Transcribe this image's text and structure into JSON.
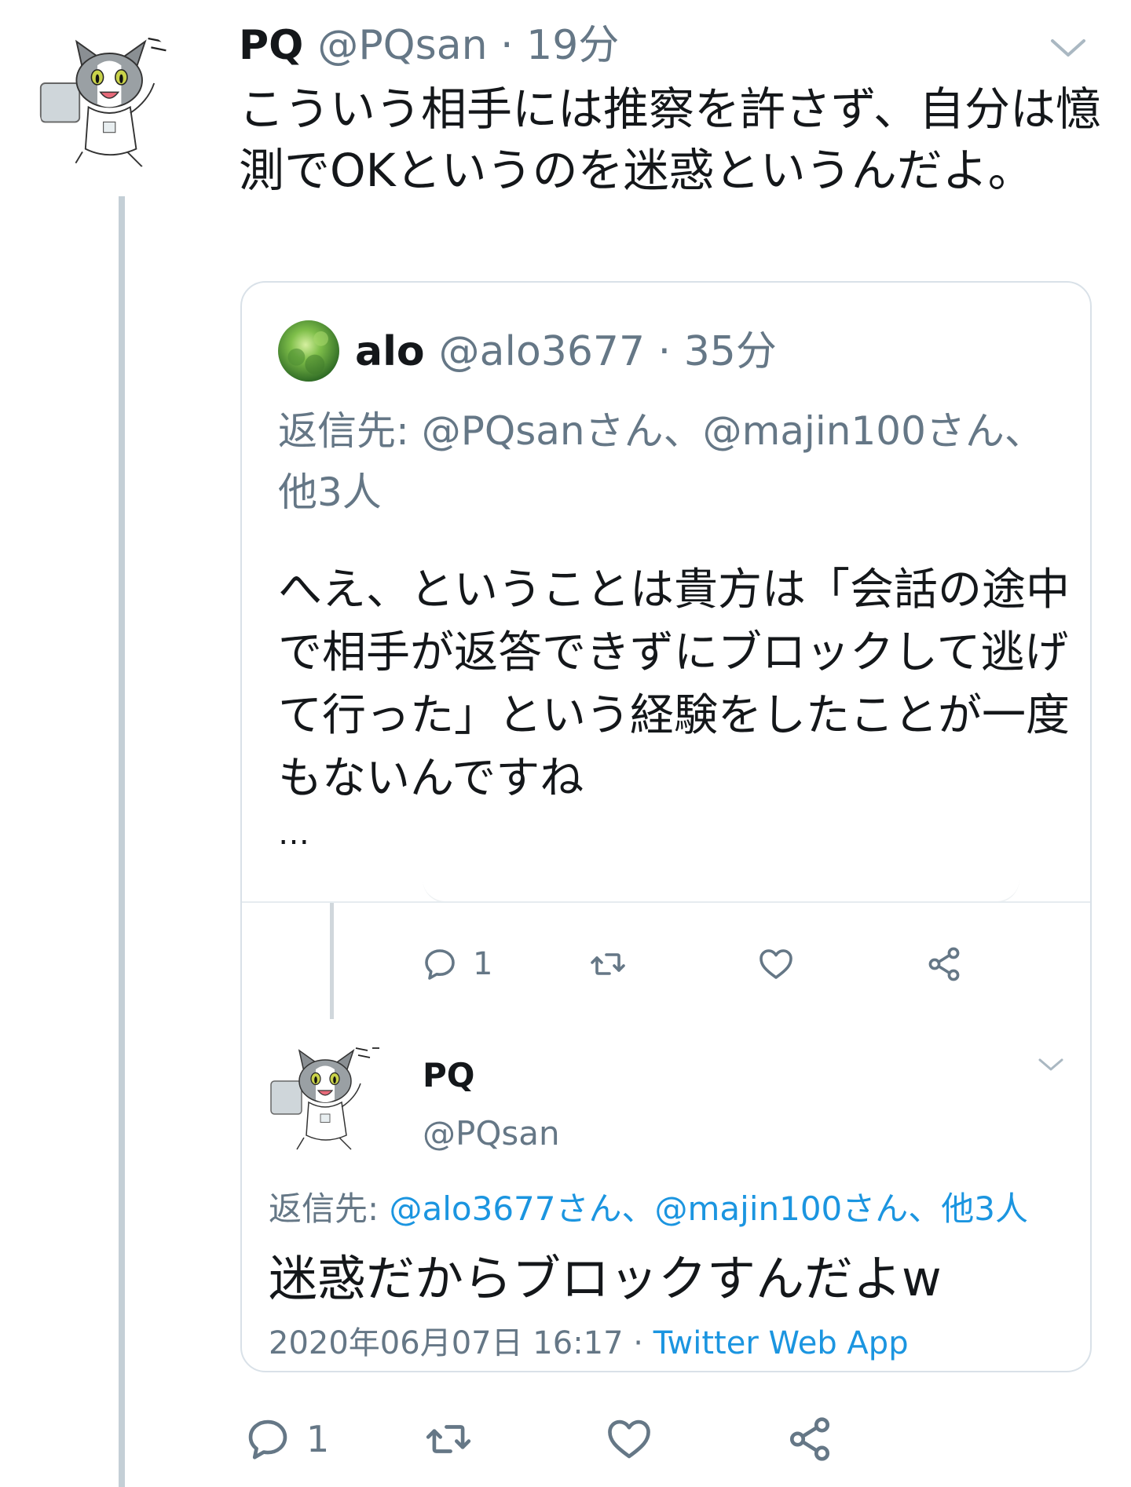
{
  "tweet": {
    "name": "PQ",
    "meta": "@PQsan · 19分",
    "text": "こういう相手には推察を許さず、自分は憶測でOKというのを迷惑というんだよ。",
    "actions": {
      "reply_count": "1"
    }
  },
  "quote": {
    "name": "alo",
    "meta": "@alo3677 · 35分",
    "reply_to": "返信先: @PQsanさん、@majin100さん、他3人",
    "text": "へえ、ということは貴方は「会話の途中で相手が返答できずにブロックして逃げて行った」という経験をしたことが一度もないんですね",
    "ellipsis": "…",
    "actions": {
      "reply_count": "1"
    },
    "nested": {
      "name": "PQ",
      "handle": "@PQsan",
      "reply_prefix": "返信先: ",
      "reply_links": "@alo3677さん、@majin100さん、他3人",
      "text": "迷惑だからブロックすんだよw",
      "timestamp": "2020年06月07日 16:17 · ",
      "source": "Twitter Web App"
    }
  },
  "icons": {
    "reply": "reply-icon",
    "retweet": "retweet-icon",
    "like": "heart-icon",
    "share": "share-icon",
    "menu": "chevron-down-icon"
  },
  "colors": {
    "text": "#14171a",
    "secondary": "#657786",
    "link": "#1b95e0",
    "border": "#d9e1e8",
    "thread": "#c4cfd6"
  }
}
